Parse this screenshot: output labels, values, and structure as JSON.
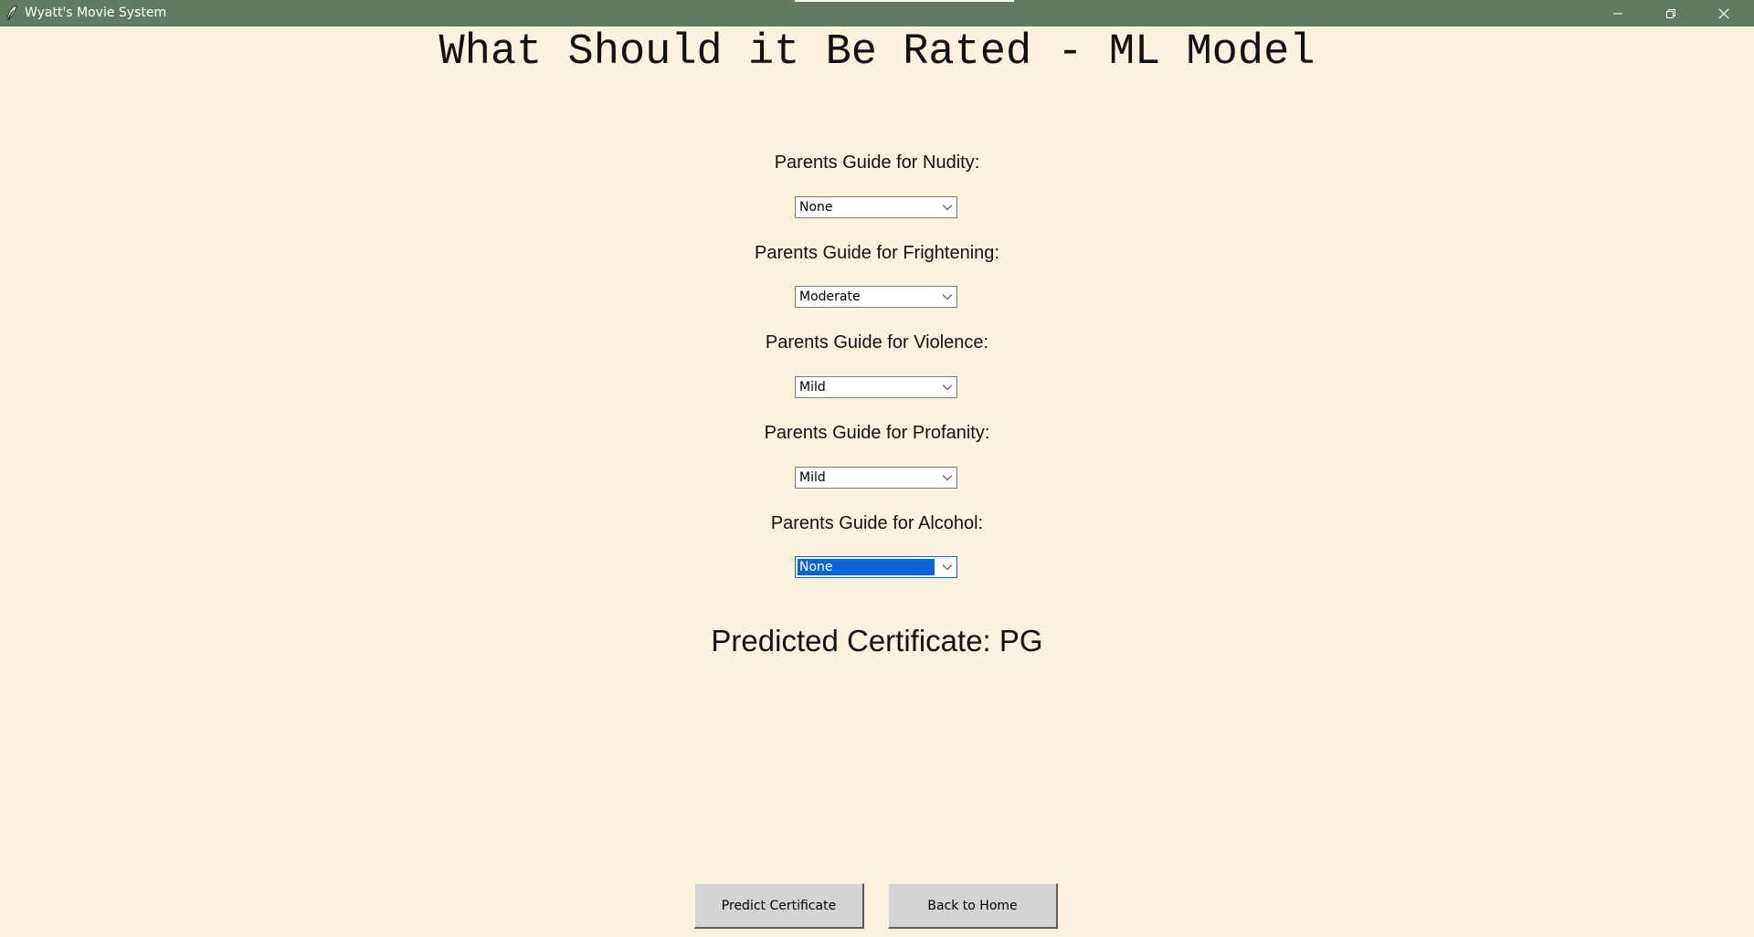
{
  "window": {
    "title": "Wyatt's Movie System",
    "controls": {
      "minimize_icon": "minimize-icon",
      "maximize_icon": "restore-icon",
      "close_icon": "close-icon"
    },
    "titlebar_color": "#627a61",
    "background_color": "#faf2df"
  },
  "page": {
    "heading": "What Should it Be Rated - ML Model"
  },
  "fields": [
    {
      "label": "Parents Guide for Nudity:",
      "value": "None"
    },
    {
      "label": "Parents Guide for Frightening:",
      "value": "Moderate"
    },
    {
      "label": "Parents Guide for Violence:",
      "value": "Mild"
    },
    {
      "label": "Parents Guide for Profanity:",
      "value": "Mild"
    },
    {
      "label": "Parents Guide for Alcohol:",
      "value": "None",
      "focused": true
    }
  ],
  "result": {
    "text": "Predicted Certificate: PG"
  },
  "buttons": {
    "predict": "Predict Certificate",
    "home": "Back to Home"
  },
  "accent_color": "#0a64d8"
}
